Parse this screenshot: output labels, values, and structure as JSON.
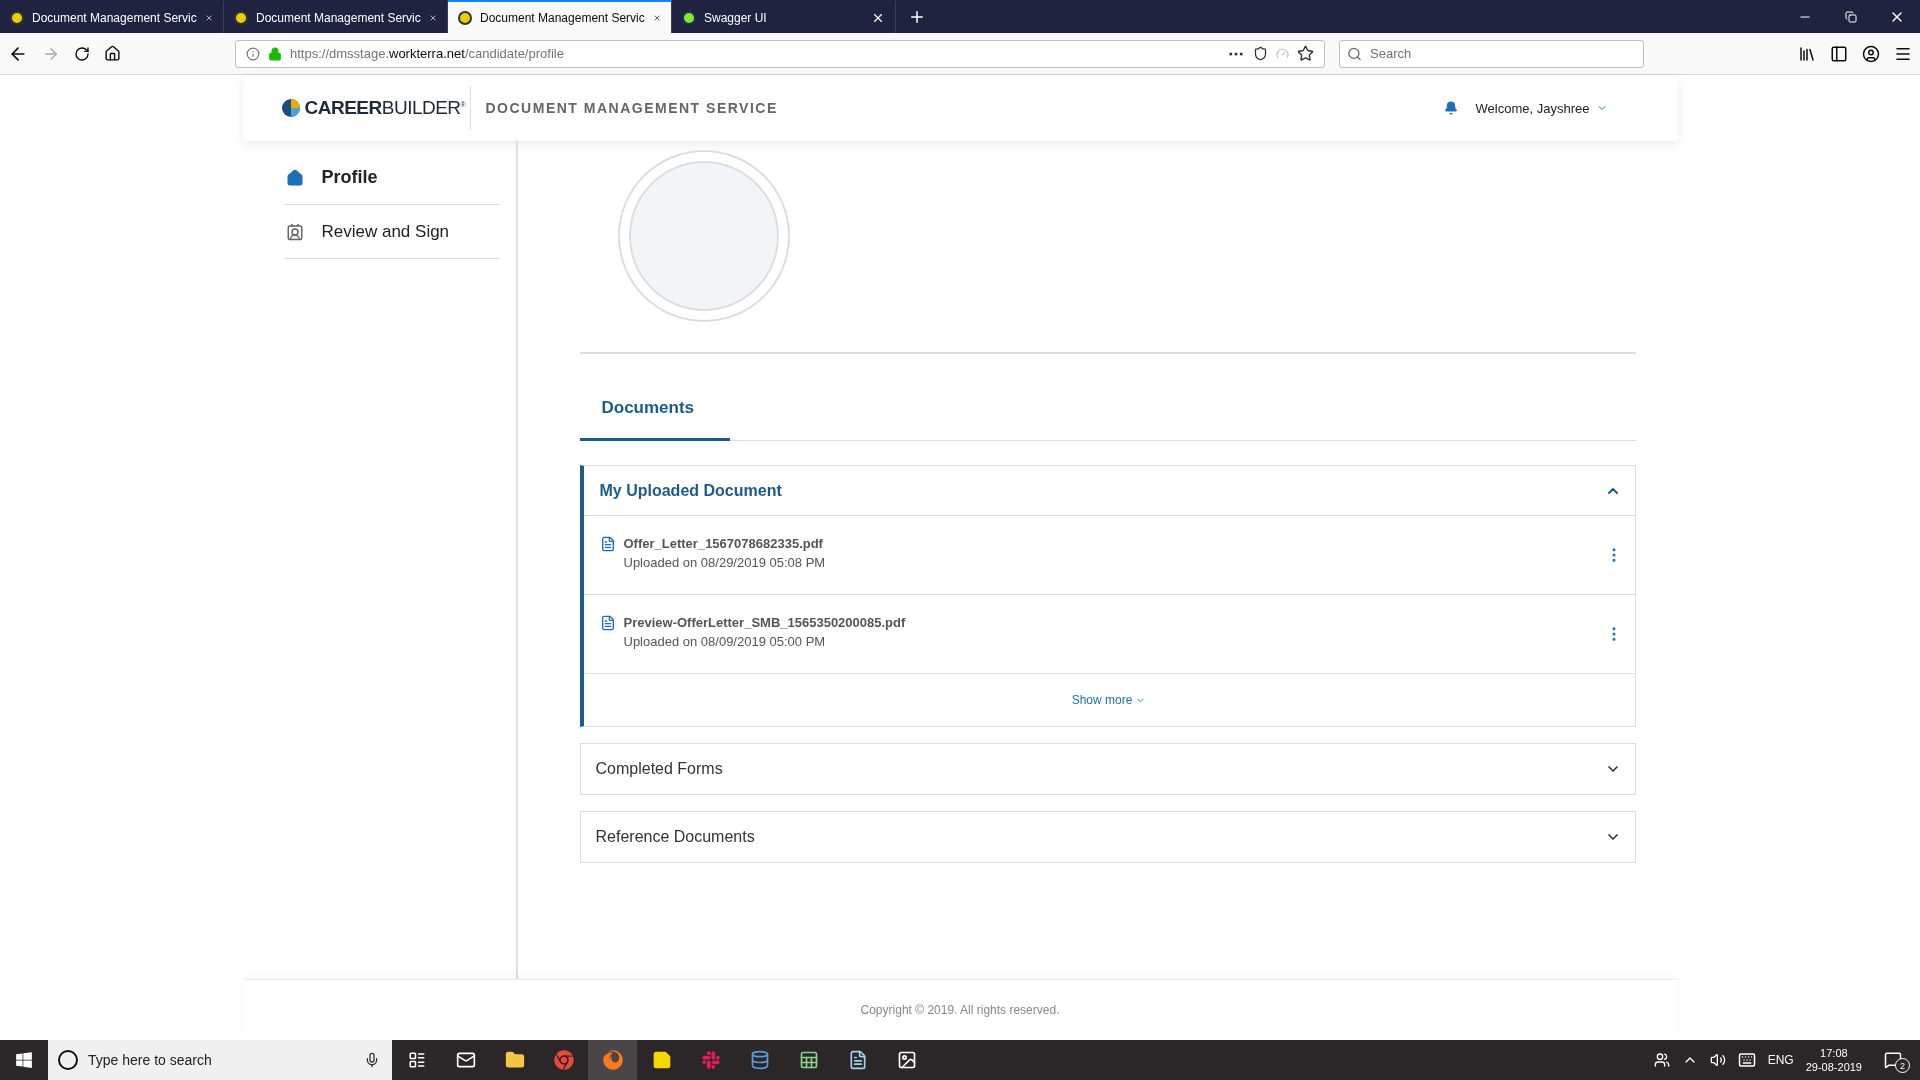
{
  "browser": {
    "tabs": [
      {
        "title": "Document Management Servic",
        "selected": false,
        "kind": "app"
      },
      {
        "title": "Document Management Servic",
        "selected": false,
        "kind": "app"
      },
      {
        "title": "Document Management Servic",
        "selected": true,
        "kind": "app"
      },
      {
        "title": "Swagger UI",
        "selected": false,
        "kind": "swagger"
      }
    ],
    "url": {
      "prefix": "https://dmsstage.",
      "domain": "workterra.net",
      "path": "/candidate/profile"
    },
    "search": {
      "placeholder": "Search"
    }
  },
  "header": {
    "logo": "**CAREER**BUILDER$^{®}$",
    "service_title": "DOCUMENT MANAGEMENT SERVICE",
    "welcome": "Welcome, Jayshree"
  },
  "sidebar": {
    "items": [
      {
        "label": "Profile",
        "selected": true,
        "kind": "home"
      },
      {
        "label": "Review and Sign",
        "selected": false,
        "kind": "badge"
      }
    ]
  },
  "tabs": [
    {
      "label": "Documents",
      "selected": true
    }
  ],
  "sections": [
    {
      "title": "My Uploaded Document",
      "expanded": true,
      "documents": [
        {
          "name": "Offer_Letter_1567078682335.pdf",
          "uploaded": "Uploaded on 08/29/2019 05:08 PM"
        },
        {
          "name": "Preview-OfferLetter_SMB_1565350200085.pdf",
          "uploaded": "Uploaded on 08/09/2019 05:00 PM"
        }
      ],
      "show_more": "Show more"
    },
    {
      "title": "Completed Forms",
      "expanded": false
    },
    {
      "title": "Reference Documents",
      "expanded": false
    }
  ],
  "footer": "Copyright © 2019. All rights reserved.",
  "taskbar": {
    "search_placeholder": "Type here to search",
    "language": "ENG",
    "time": "17:08",
    "date": "29-08-2019",
    "notifications": "2"
  }
}
